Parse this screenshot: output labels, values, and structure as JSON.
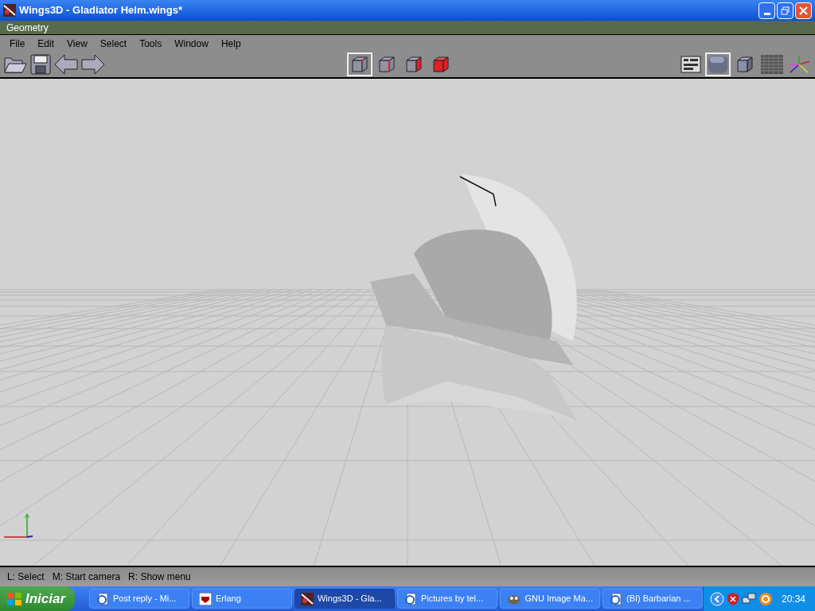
{
  "window": {
    "title": "Wings3D - Gladiator Helm.wings*"
  },
  "viewport_title": "Geometry",
  "menu": [
    "File",
    "Edit",
    "View",
    "Select",
    "Tools",
    "Window",
    "Help"
  ],
  "selection_modes": [
    {
      "kind": "vertex",
      "selected": true
    },
    {
      "kind": "edge",
      "selected": false
    },
    {
      "kind": "face",
      "selected": false
    },
    {
      "kind": "body",
      "selected": false
    }
  ],
  "view_buttons": [
    {
      "kind": "outliner",
      "selected": false
    },
    {
      "kind": "smooth",
      "selected": true
    },
    {
      "kind": "wire",
      "selected": false
    },
    {
      "kind": "ground",
      "selected": false
    },
    {
      "kind": "axes",
      "selected": false
    }
  ],
  "status_bar": "L: Select   M: Start camera   R: Show menu",
  "taskbar": {
    "start": "Iniciar",
    "items": [
      {
        "label": "Post reply - Mi...",
        "kind": "browser",
        "selected": false
      },
      {
        "label": "Erlang",
        "kind": "erlang",
        "selected": false
      },
      {
        "label": "Wings3D - Gla...",
        "kind": "wings",
        "selected": true
      },
      {
        "label": "Pictures by tel...",
        "kind": "browser",
        "selected": false
      },
      {
        "label": "GNU Image Ma...",
        "kind": "gimp",
        "selected": false
      },
      {
        "label": "(BI) Barbarian ...",
        "kind": "browser",
        "selected": false
      }
    ],
    "clock": "20:34"
  }
}
